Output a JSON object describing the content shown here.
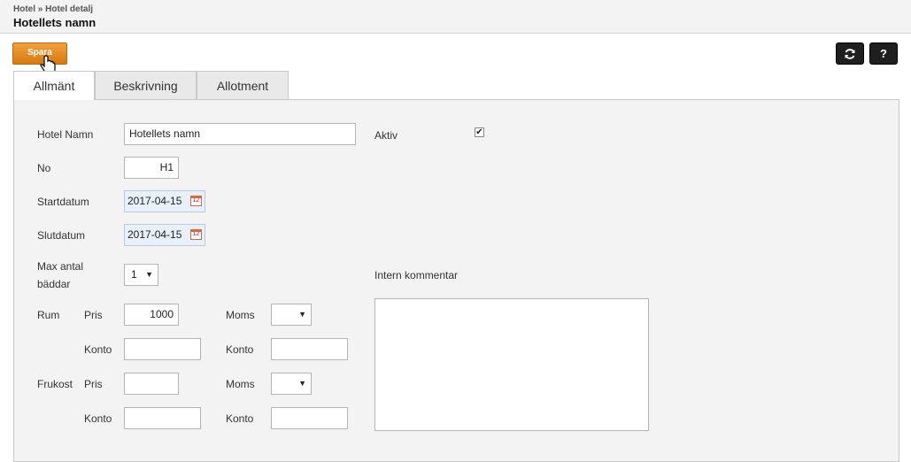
{
  "header": {
    "breadcrumb": "Hotel » Hotel detalj",
    "title": "Hotellets namn"
  },
  "toolbar": {
    "save_label": "Spara",
    "refresh_icon": "refresh-icon",
    "help_label": "?"
  },
  "tabs": [
    {
      "label": "Allmänt",
      "active": true
    },
    {
      "label": "Beskrivning",
      "active": false
    },
    {
      "label": "Allotment",
      "active": false
    }
  ],
  "form": {
    "hotel_namn_label": "Hotel Namn",
    "hotel_namn_value": "Hotellets namn",
    "aktiv_label": "Aktiv",
    "aktiv_checked": true,
    "no_label": "No",
    "no_value": "H1",
    "startdatum_label": "Startdatum",
    "startdatum_value": "2017-04-15",
    "slutdatum_label": "Slutdatum",
    "slutdatum_value": "2017-04-15",
    "max_antal_label_1": "Max antal",
    "max_antal_label_2": "bäddar",
    "max_antal_value": "1",
    "intern_kommentar_label": "Intern kommentar",
    "intern_kommentar_value": "",
    "rum_label": "Rum",
    "frukost_label": "Frukost",
    "pris_label": "Pris",
    "konto_label": "Konto",
    "moms_label": "Moms",
    "rum_pris_value": "1000",
    "rum_konto_value": "",
    "rum_moms_value": "",
    "rum_moms_konto_value": "",
    "frukost_pris_value": "",
    "frukost_konto_value": "",
    "frukost_moms_value": "",
    "frukost_moms_konto_value": "",
    "calendar_icon_text": "12"
  },
  "colors": {
    "save_button": "#e08a20",
    "tool_button": "#1f1f1f",
    "date_field": "#e8f0fb"
  }
}
